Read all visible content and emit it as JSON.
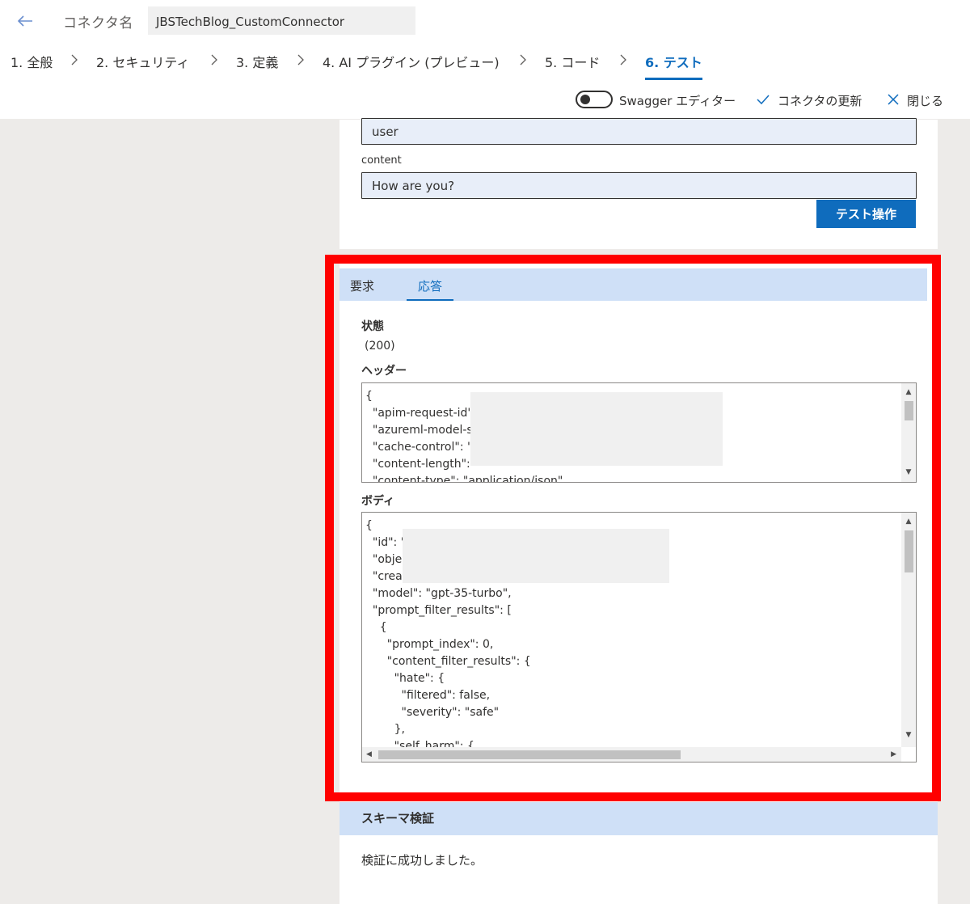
{
  "header": {
    "connector_label": "コネクタ名",
    "connector_name": "JBSTechBlog_CustomConnector"
  },
  "steps": [
    {
      "label": "1. 全般"
    },
    {
      "label": "2. セキュリティ"
    },
    {
      "label": "3. 定義"
    },
    {
      "label": "4. AI プラグイン (プレビュー)"
    },
    {
      "label": "5. コード"
    },
    {
      "label": "6. テスト",
      "active": true
    }
  ],
  "actions": {
    "swagger_label": "Swagger エディター",
    "update_label": "コネクタの更新",
    "close_label": "閉じる"
  },
  "request_form": {
    "role_value": "user",
    "content_label": "content",
    "content_value": "How are you?",
    "test_button": "テスト操作"
  },
  "response": {
    "tabs": [
      "要求",
      "応答"
    ],
    "active_tab": "応答",
    "status_label": "状態",
    "status_value": "(200)",
    "headers_label": "ヘッダー",
    "headers_text": "{\n  \"apim-request-id\"\n  \"azureml-model-s\n  \"cache-control\": \"r\n  \"content-length\": \"\n  \"content-type\": \"application/json\",",
    "body_label": "ボディ",
    "body_text": "{\n  \"id\": \"\n  \"obje\n  \"creat\n  \"model\": \"gpt-35-turbo\",\n  \"prompt_filter_results\": [\n    {\n      \"prompt_index\": 0,\n      \"content_filter_results\": {\n        \"hate\": {\n          \"filtered\": false,\n          \"severity\": \"safe\"\n        },\n        \"self_harm\": {"
  },
  "schema": {
    "title": "スキーマ検証",
    "message": "検証に成功しました。"
  },
  "colors": {
    "accent": "#0f6cbd",
    "highlight_frame": "#ff0000",
    "section_bar": "#cfe0f7"
  }
}
